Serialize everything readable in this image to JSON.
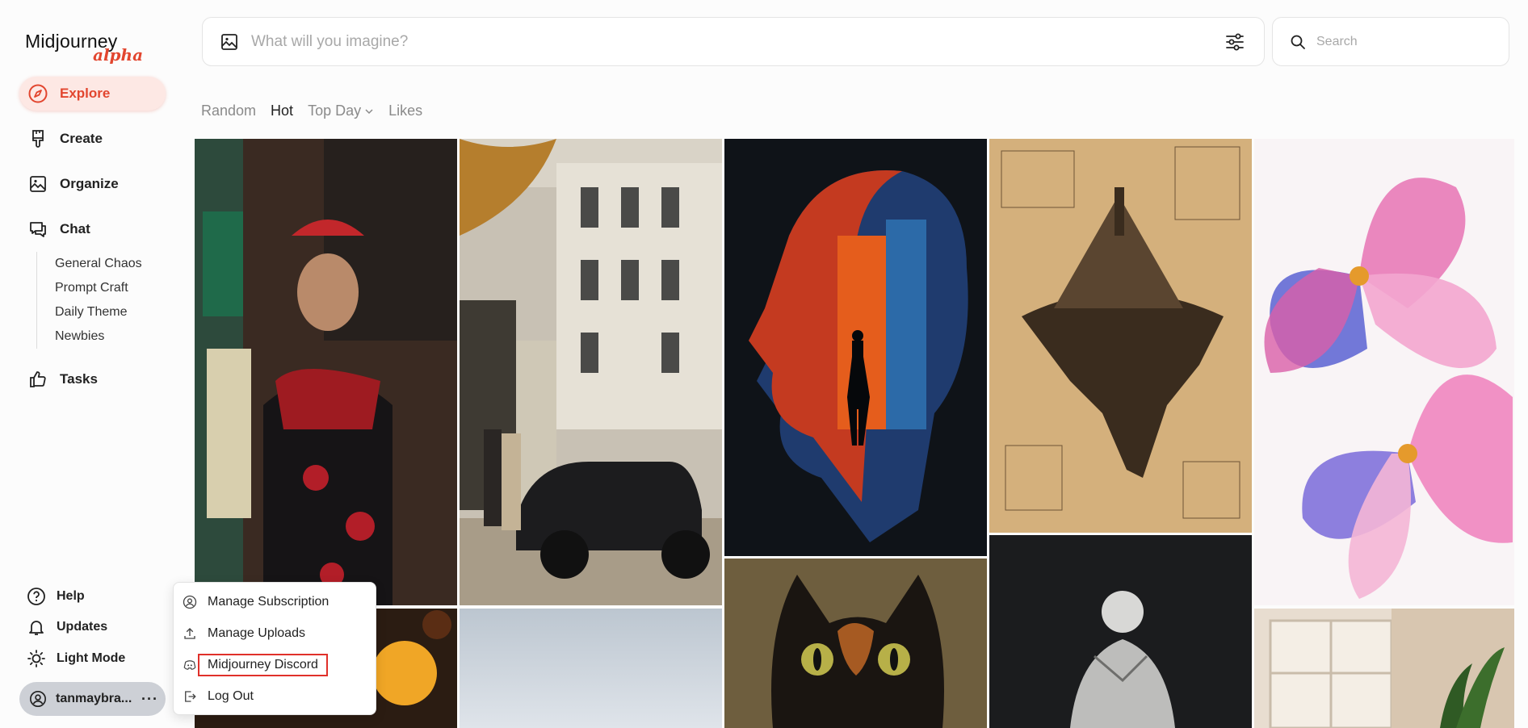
{
  "brand": {
    "name": "Midjourney",
    "sub": "alpha",
    "accent": "#e2462f"
  },
  "sidebar": {
    "nav": [
      {
        "label": "Explore",
        "icon": "compass-icon"
      },
      {
        "label": "Create",
        "icon": "brush-icon"
      },
      {
        "label": "Organize",
        "icon": "image-icon"
      },
      {
        "label": "Chat",
        "icon": "chat-icon"
      },
      {
        "label": "Tasks",
        "icon": "thumbs-up-icon"
      }
    ],
    "chat_rooms": [
      "General Chaos",
      "Prompt Craft",
      "Daily Theme",
      "Newbies"
    ],
    "bottom": [
      {
        "label": "Help",
        "icon": "help-icon"
      },
      {
        "label": "Updates",
        "icon": "bell-icon"
      },
      {
        "label": "Light Mode",
        "icon": "sun-icon"
      }
    ],
    "user": {
      "name": "tanmaybra...",
      "more": "···"
    }
  },
  "prompt": {
    "placeholder": "What will you imagine?"
  },
  "search": {
    "placeholder": "Search"
  },
  "tabs": [
    "Random",
    "Hot",
    "Top Day",
    "Likes"
  ],
  "active_tab": "Hot",
  "user_menu": {
    "items": [
      {
        "label": "Manage Subscription",
        "icon": "user-circle-icon"
      },
      {
        "label": "Manage Uploads",
        "icon": "upload-icon"
      },
      {
        "label": "Midjourney Discord",
        "icon": "discord-icon",
        "highlighted": true
      },
      {
        "label": "Log Out",
        "icon": "logout-icon"
      }
    ]
  },
  "gallery": [
    "woman-phone-booth-image",
    "mansion-vintage-car-image",
    "silhouette-city-image",
    "floating-island-sketch-image",
    "watercolor-flowers-image",
    "bokeh-lights-image",
    "sky-image",
    "black-cat-painting-image",
    "statue-image",
    "window-plant-image"
  ]
}
